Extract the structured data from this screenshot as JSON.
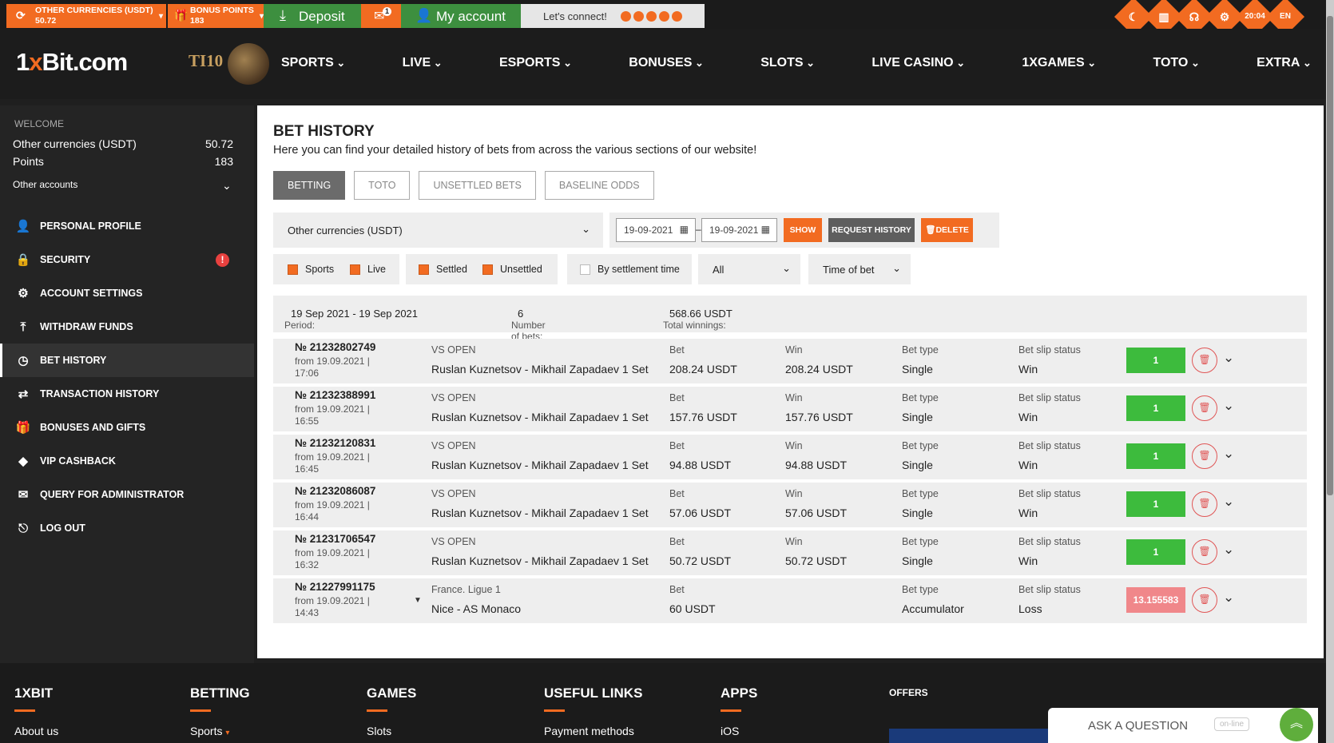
{
  "topbar": {
    "currency_label": "OTHER CURRENCIES (USDT)",
    "currency_value": "50.72",
    "bonus_label": "BONUS POINTS",
    "bonus_value": "183",
    "deposit": "Deposit",
    "mail_count": "1",
    "my_account": "My account",
    "lets_connect": "Let's connect!",
    "time": "20:04",
    "lang": "EN"
  },
  "header": {
    "logo_a": "1",
    "logo_x": "x",
    "logo_b": "Bit.com",
    "ti": "TI10",
    "nav": [
      "SPORTS",
      "LIVE",
      "ESPORTS",
      "BONUSES",
      "SLOTS",
      "LIVE CASINO",
      "1XGAMES",
      "TOTO",
      "EXTRA"
    ]
  },
  "sidebar": {
    "welcome": "WELCOME",
    "currency_label": "Other currencies (USDT)",
    "currency_value": "50.72",
    "points_label": "Points",
    "points_value": "183",
    "other_accounts": "Other accounts",
    "security_alert": "!",
    "items": [
      {
        "label": "PERSONAL PROFILE",
        "icon": "user-add-icon"
      },
      {
        "label": "SECURITY",
        "icon": "lock-icon"
      },
      {
        "label": "ACCOUNT SETTINGS",
        "icon": "gears-icon"
      },
      {
        "label": "WITHDRAW FUNDS",
        "icon": "upload-icon"
      },
      {
        "label": "BET HISTORY",
        "icon": "clock-icon"
      },
      {
        "label": "TRANSACTION HISTORY",
        "icon": "arrows-icon"
      },
      {
        "label": "BONUSES AND GIFTS",
        "icon": "gift-icon"
      },
      {
        "label": "VIP CASHBACK",
        "icon": "diamond-icon"
      },
      {
        "label": "QUERY FOR ADMINISTRATOR",
        "icon": "envelope-icon"
      },
      {
        "label": "LOG OUT",
        "icon": "logout-icon"
      }
    ]
  },
  "main": {
    "title": "BET HISTORY",
    "subtitle": "Here you can find your detailed history of bets from across the various sections of our website!",
    "tabs": [
      "BETTING",
      "TOTO",
      "UNSETTLED BETS",
      "BASELINE ODDS"
    ],
    "currency_select": "Other currencies (USDT)",
    "date_from": "19-09-2021",
    "date_to": "19-09-2021",
    "show": "SHOW",
    "request_history": "REQUEST HISTORY",
    "delete": "DELETE",
    "filters": {
      "sports": "Sports",
      "live": "Live",
      "settled": "Settled",
      "unsettled": "Unsettled",
      "by_settlement": "By settlement time",
      "all": "All",
      "time_of_bet": "Time of bet"
    },
    "summary": {
      "period_label": "Period:",
      "period_value": "19 Sep 2021 - 19 Sep 2021",
      "bets_label": "Number of bets:",
      "bets_value": "6",
      "winnings_label": "Total winnings:",
      "winnings_value": "568.66 USDT"
    },
    "col_bet": "Bet",
    "col_win": "Win",
    "col_type": "Bet type",
    "col_status": "Bet slip status",
    "bets": [
      {
        "num": "№ 21232802749",
        "from": "from 19.09.2021 | 17:06",
        "league": "VS OPEN",
        "match": "Ruslan Kuznetsov - Mikhail Zapadaev 1 Set",
        "bet": "208.24 USDT",
        "win": "208.24 USDT",
        "type": "Single",
        "status": "Win",
        "odd": "1"
      },
      {
        "num": "№ 21232388991",
        "from": "from 19.09.2021 | 16:55",
        "league": "VS OPEN",
        "match": "Ruslan Kuznetsov - Mikhail Zapadaev 1 Set",
        "bet": "157.76 USDT",
        "win": "157.76 USDT",
        "type": "Single",
        "status": "Win",
        "odd": "1"
      },
      {
        "num": "№ 21232120831",
        "from": "from 19.09.2021 | 16:45",
        "league": "VS OPEN",
        "match": "Ruslan Kuznetsov - Mikhail Zapadaev 1 Set",
        "bet": "94.88 USDT",
        "win": "94.88 USDT",
        "type": "Single",
        "status": "Win",
        "odd": "1"
      },
      {
        "num": "№ 21232086087",
        "from": "from 19.09.2021 | 16:44",
        "league": "VS OPEN",
        "match": "Ruslan Kuznetsov - Mikhail Zapadaev 1 Set",
        "bet": "57.06 USDT",
        "win": "57.06 USDT",
        "type": "Single",
        "status": "Win",
        "odd": "1"
      },
      {
        "num": "№ 21231706547",
        "from": "from 19.09.2021 | 16:32",
        "league": "VS OPEN",
        "match": "Ruslan Kuznetsov - Mikhail Zapadaev 1 Set",
        "bet": "50.72 USDT",
        "win": "50.72 USDT",
        "type": "Single",
        "status": "Win",
        "odd": "1"
      },
      {
        "num": "№ 21227991175",
        "from": "from 19.09.2021 | 14:43",
        "league": "France. Ligue 1",
        "match": "Nice - AS Monaco",
        "bet": "60 USDT",
        "win": "",
        "type": "Accumulator",
        "status": "Loss",
        "odd": "13.155583"
      }
    ]
  },
  "footer": {
    "cols": [
      {
        "title": "1XBIT",
        "link": "About us"
      },
      {
        "title": "BETTING",
        "link": "Sports"
      },
      {
        "title": "GAMES",
        "link": "Slots"
      },
      {
        "title": "USEFUL LINKS",
        "link": "Payment methods"
      },
      {
        "title": "APPS",
        "link": "iOS"
      }
    ],
    "offers": "OFFERS",
    "ask": "ASK A QUESTION",
    "online": "on-line"
  },
  "colors": {
    "accent": "#f26b21",
    "green": "#3d8f3f",
    "win": "#3dbb3d",
    "loss": "#f0878a"
  }
}
